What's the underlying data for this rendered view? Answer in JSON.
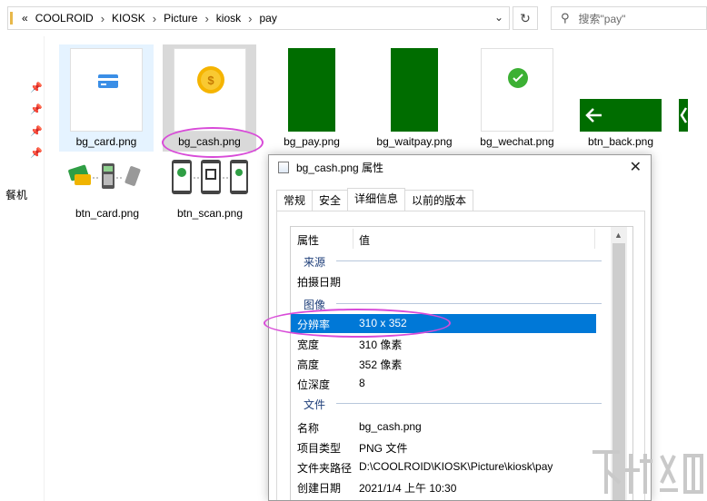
{
  "address": {
    "overflow": "«",
    "crumbs": [
      "COOLROID",
      "KIOSK",
      "Picture",
      "kiosk",
      "pay"
    ],
    "separator": "›"
  },
  "search": {
    "placeholder": "搜索\"pay\""
  },
  "nav": {
    "partial_label": "餐机"
  },
  "files": [
    {
      "name": "bg_card.png"
    },
    {
      "name": "bg_cash.png"
    },
    {
      "name": "bg_pay.png"
    },
    {
      "name": "bg_waitpay.png"
    },
    {
      "name": "bg_wechat.png"
    },
    {
      "name": "btn_back.png"
    },
    {
      "name": "btn_card.png"
    },
    {
      "name": "btn_scan.png"
    }
  ],
  "colors": {
    "green": "#006d00",
    "wechat_green": "#3cb034",
    "selection_blue": "#0078d7",
    "annotation": "#d84bd8"
  },
  "dialog": {
    "title": "bg_cash.png 属性",
    "tabs": [
      "常规",
      "安全",
      "详细信息",
      "以前的版本"
    ],
    "active_tab": "详细信息",
    "header": {
      "prop": "属性",
      "value": "值"
    },
    "groups": {
      "source": "来源",
      "image": "图像",
      "file": "文件"
    },
    "rows": {
      "date_taken": {
        "k": "拍摄日期",
        "v": ""
      },
      "resolution": {
        "k": "分辨率",
        "v": "310 x 352"
      },
      "width": {
        "k": "宽度",
        "v": "310 像素"
      },
      "height": {
        "k": "高度",
        "v": "352 像素"
      },
      "bit_depth": {
        "k": "位深度",
        "v": "8"
      },
      "name": {
        "k": "名称",
        "v": "bg_cash.png"
      },
      "item_type": {
        "k": "项目类型",
        "v": "PNG 文件"
      },
      "folder_path": {
        "k": "文件夹路径",
        "v": "D:\\COOLROID\\KIOSK\\Picture\\kiosk\\pay"
      },
      "created": {
        "k": "创建日期",
        "v": "2021/1/4 上午 10:30"
      }
    }
  }
}
